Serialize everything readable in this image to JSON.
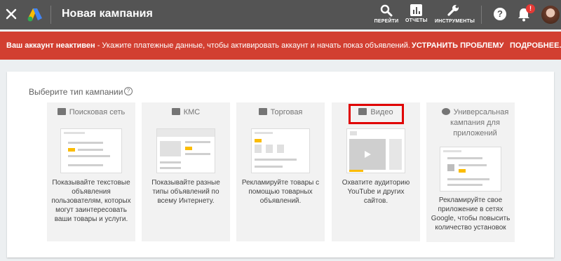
{
  "header": {
    "title": "Новая кампания",
    "tools": [
      {
        "label": "ПЕРЕЙТИ",
        "icon": "search-icon"
      },
      {
        "label": "ОТЧЕТЫ",
        "icon": "reports-icon"
      },
      {
        "label": "ИНСТРУМЕНТЫ",
        "icon": "wrench-icon"
      }
    ],
    "help": "?",
    "notification_badge": "!"
  },
  "banner": {
    "lead": "Ваш аккаунт неактивен",
    "message": " - Укажите платежные данные, чтобы активировать аккаунт и начать показ объявлений.",
    "fix_label": "УСТРАНИТЬ ПРОБЛЕМУ",
    "more_label": "ПОДРОБНЕЕ...",
    "color": "#d23f31"
  },
  "main": {
    "prompt": "Выберите тип кампании",
    "campaign_types": [
      {
        "title": "Поисковая сеть",
        "icon": "search-icon",
        "description": "Показывайте текстовые объявления пользователям, которых могут заинтересовать ваши товары и услуги."
      },
      {
        "title": "КМС",
        "icon": "display-icon",
        "description": "Показывайте разные типы объявлений по всему Интернету."
      },
      {
        "title": "Торговая",
        "icon": "tag-icon",
        "description": "Рекламируйте товары с помощью товарных объявлений."
      },
      {
        "title": "Видео",
        "icon": "video-icon",
        "description": "Охватите аудиторию YouTube и других сайтов."
      },
      {
        "title": "Универсальная кампания для приложений",
        "icon": "download-icon",
        "description": "Рекламируйте свое приложение в сетях Google, чтобы повысить количество установок"
      }
    ],
    "accent_color": "#fbbc04",
    "highlight_color": "#e00000"
  }
}
